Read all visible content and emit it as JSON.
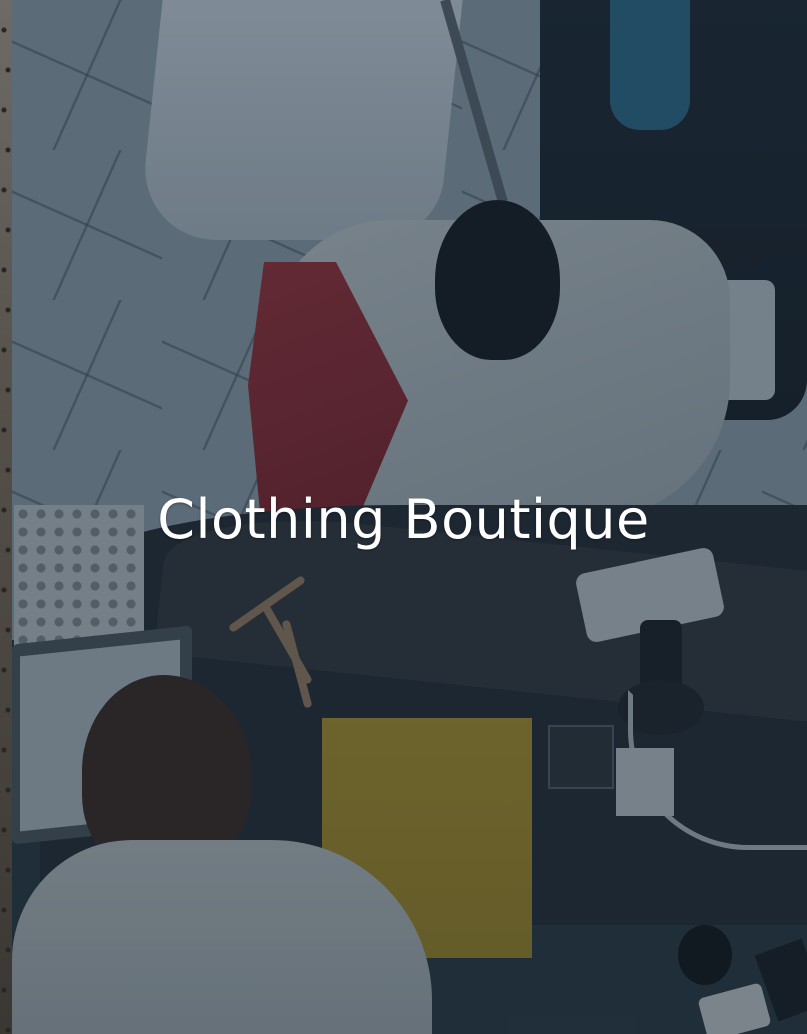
{
  "title": "Clothing Boutique"
}
